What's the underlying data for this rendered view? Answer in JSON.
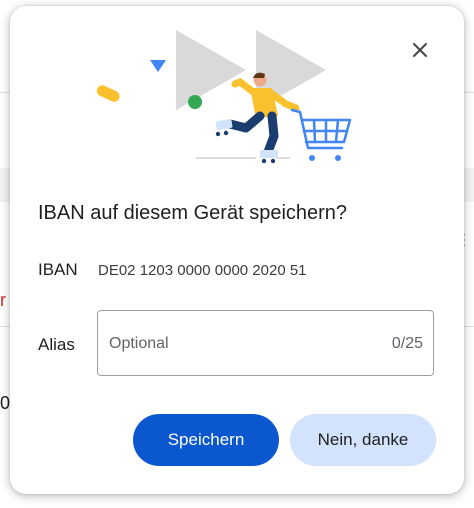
{
  "background": {
    "left_fragment_1": "r",
    "left_fragment_2": "0"
  },
  "dialog": {
    "title": "IBAN auf diesem Gerät speichern?",
    "close_icon": "close-icon",
    "iban_label": "IBAN",
    "iban_value": "DE02 1203 0000 0000 2020 51",
    "alias_label": "Alias",
    "alias_placeholder": "Optional",
    "alias_value": "",
    "alias_counter": "0/25",
    "save_button": "Speichern",
    "decline_button": "Nein, danke"
  },
  "colors": {
    "primary": "#0b57d0",
    "secondary": "#d3e3fd",
    "illustration_yellow": "#fbc02d",
    "illustration_blue": "#4285f4",
    "illustration_green": "#34a853",
    "illustration_gray": "#d9d9d9"
  }
}
